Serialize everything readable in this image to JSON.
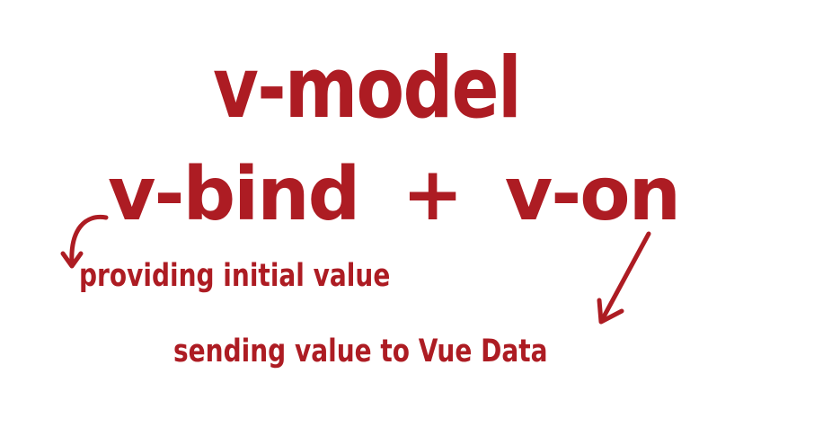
{
  "heading": "v-model",
  "formula": {
    "left_term": "v-bind",
    "operator": "+",
    "right_term": "v-on"
  },
  "annotations": {
    "left": "providing initial value",
    "right": "sending value to Vue Data"
  },
  "colors": {
    "ink": "#ad1c23",
    "background": "#ffffff"
  }
}
